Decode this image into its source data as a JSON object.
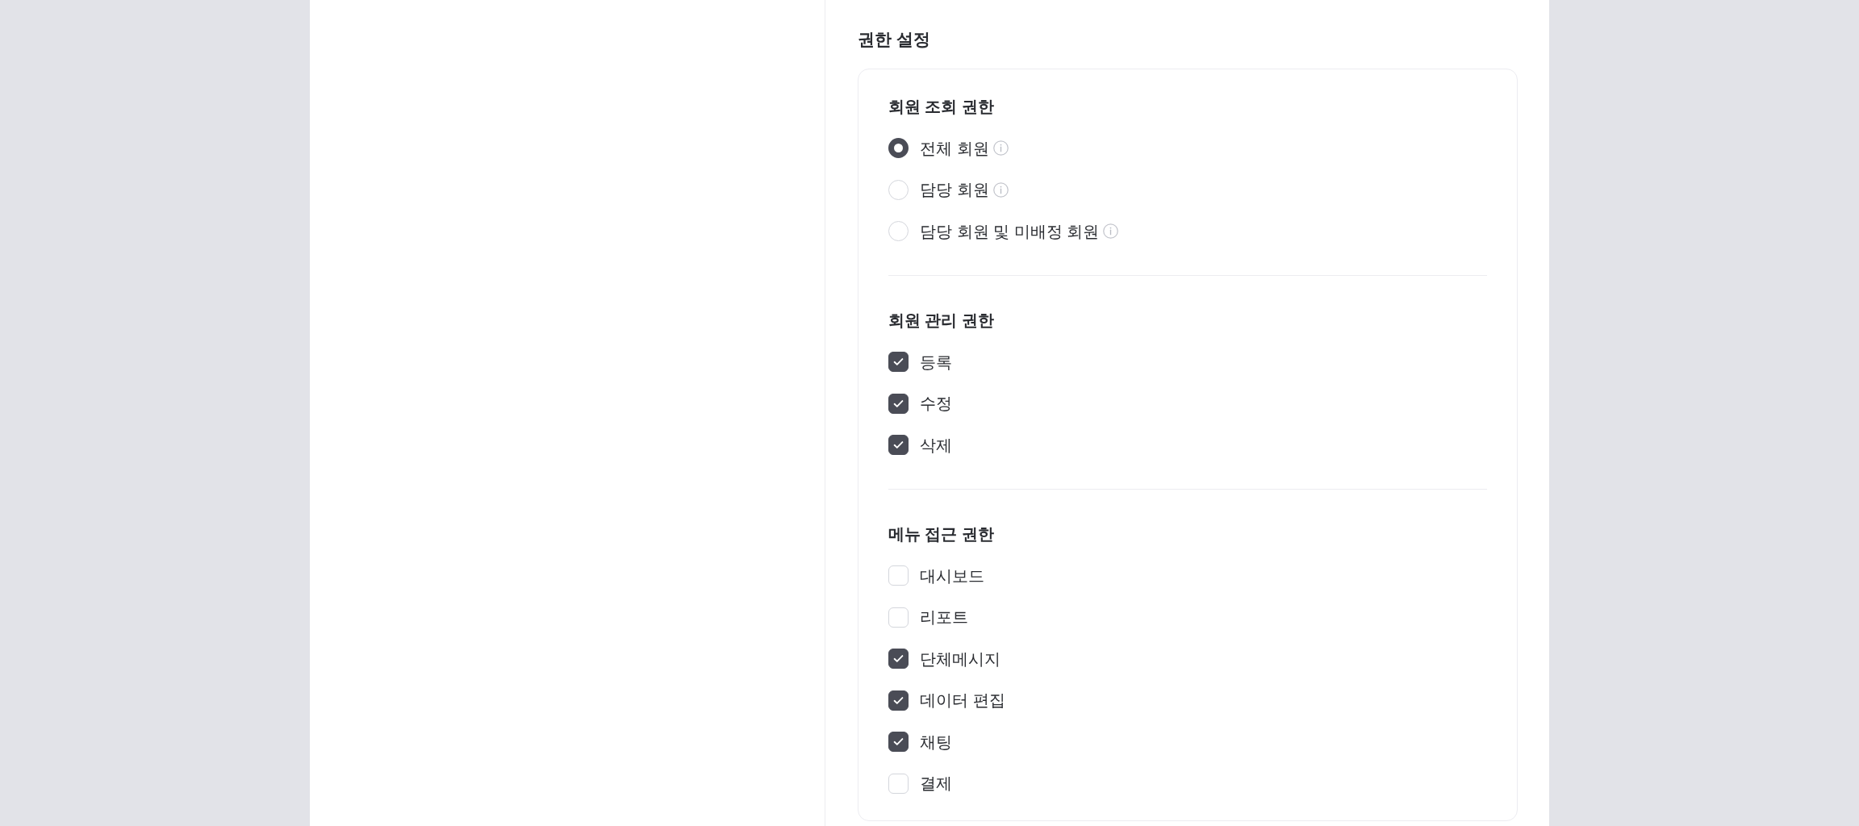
{
  "section": {
    "title": "권한 설정"
  },
  "groups": [
    {
      "title": "회원 조회 권한",
      "kind": "radio",
      "options": [
        {
          "label": "전체 회원",
          "selected": true,
          "info": true
        },
        {
          "label": "담당 회원",
          "selected": false,
          "info": true
        },
        {
          "label": "담당 회원 및 미배정 회원",
          "selected": false,
          "info": true
        }
      ]
    },
    {
      "title": "회원 관리 권한",
      "kind": "checkbox",
      "options": [
        {
          "label": "등록",
          "checked": true
        },
        {
          "label": "수정",
          "checked": true
        },
        {
          "label": "삭제",
          "checked": true
        }
      ]
    },
    {
      "title": "메뉴 접근 권한",
      "kind": "checkbox",
      "options": [
        {
          "label": "대시보드",
          "checked": false
        },
        {
          "label": "리포트",
          "checked": false
        },
        {
          "label": "단체메시지",
          "checked": true
        },
        {
          "label": "데이터 편집",
          "checked": true
        },
        {
          "label": "채팅",
          "checked": true
        },
        {
          "label": "결제",
          "checked": false
        }
      ]
    }
  ]
}
